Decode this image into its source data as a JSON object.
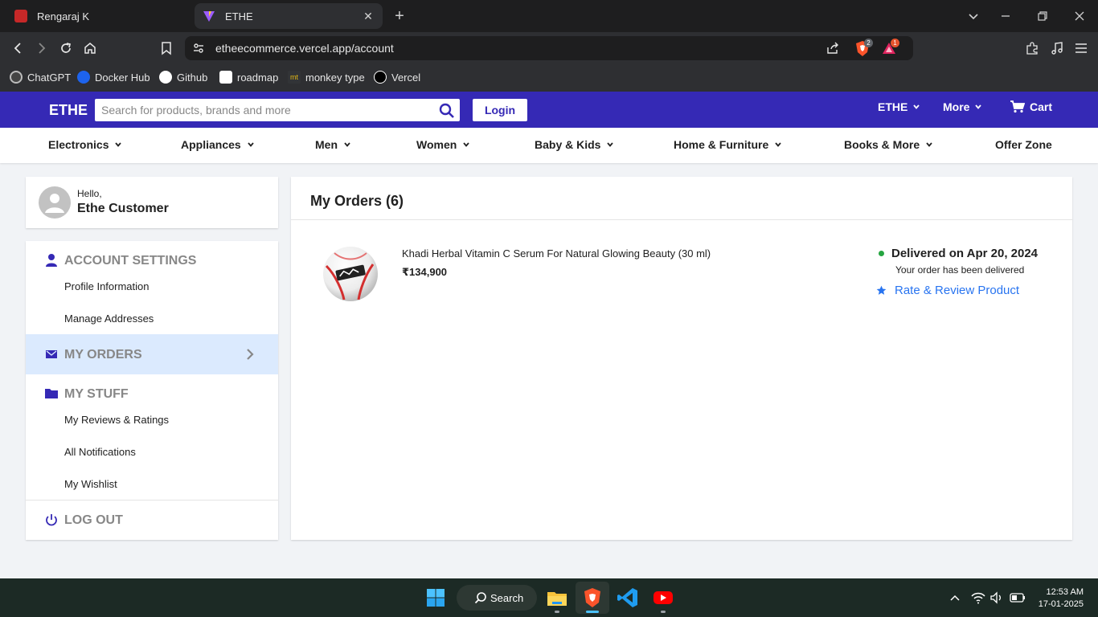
{
  "browser": {
    "tabs": [
      {
        "title": "Rengaraj K",
        "active": false
      },
      {
        "title": "ETHE",
        "active": true
      }
    ],
    "url": "etheecommerce.vercel.app/account",
    "shield_badge": "2",
    "alert_badge": "1",
    "bookmarks": [
      "ChatGPT",
      "Docker Hub",
      "Github",
      "roadmap",
      "monkey type",
      "Vercel"
    ]
  },
  "header": {
    "logo": "ETHE",
    "search_placeholder": "Search for products, brands and more",
    "login_label": "Login",
    "links": [
      "ETHE",
      "More",
      "Cart"
    ]
  },
  "categories": [
    "Electronics",
    "Appliances",
    "Men",
    "Women",
    "Baby & Kids",
    "Home & Furniture",
    "Books & More",
    "Offer Zone"
  ],
  "sidebar": {
    "greeting": "Hello,",
    "user_name": "Ethe Customer",
    "account_settings": "ACCOUNT SETTINGS",
    "profile_information": "Profile Information",
    "manage_addresses": "Manage Addresses",
    "my_orders": "MY ORDERS",
    "my_stuff": "MY STUFF",
    "my_reviews": "My Reviews & Ratings",
    "all_notifications": "All Notifications",
    "my_wishlist": "My Wishlist",
    "logout": "LOG OUT"
  },
  "orders": {
    "title": "My Orders (6)",
    "items": [
      {
        "name": "Khadi Herbal Vitamin C Serum For Natural Glowing Beauty (30 ml)",
        "price": "₹134,900",
        "status": "Delivered on Apr 20, 2024",
        "status_note": "Your order has been delivered",
        "action": "Rate & Review Product"
      }
    ]
  },
  "taskbar": {
    "search_label": "Search",
    "time": "12:53 AM",
    "date": "17-01-2025"
  },
  "colors": {
    "brand": "#3529b5",
    "link": "#2874f0",
    "delivered": "#26a541",
    "selected_row": "#dbeafe"
  }
}
